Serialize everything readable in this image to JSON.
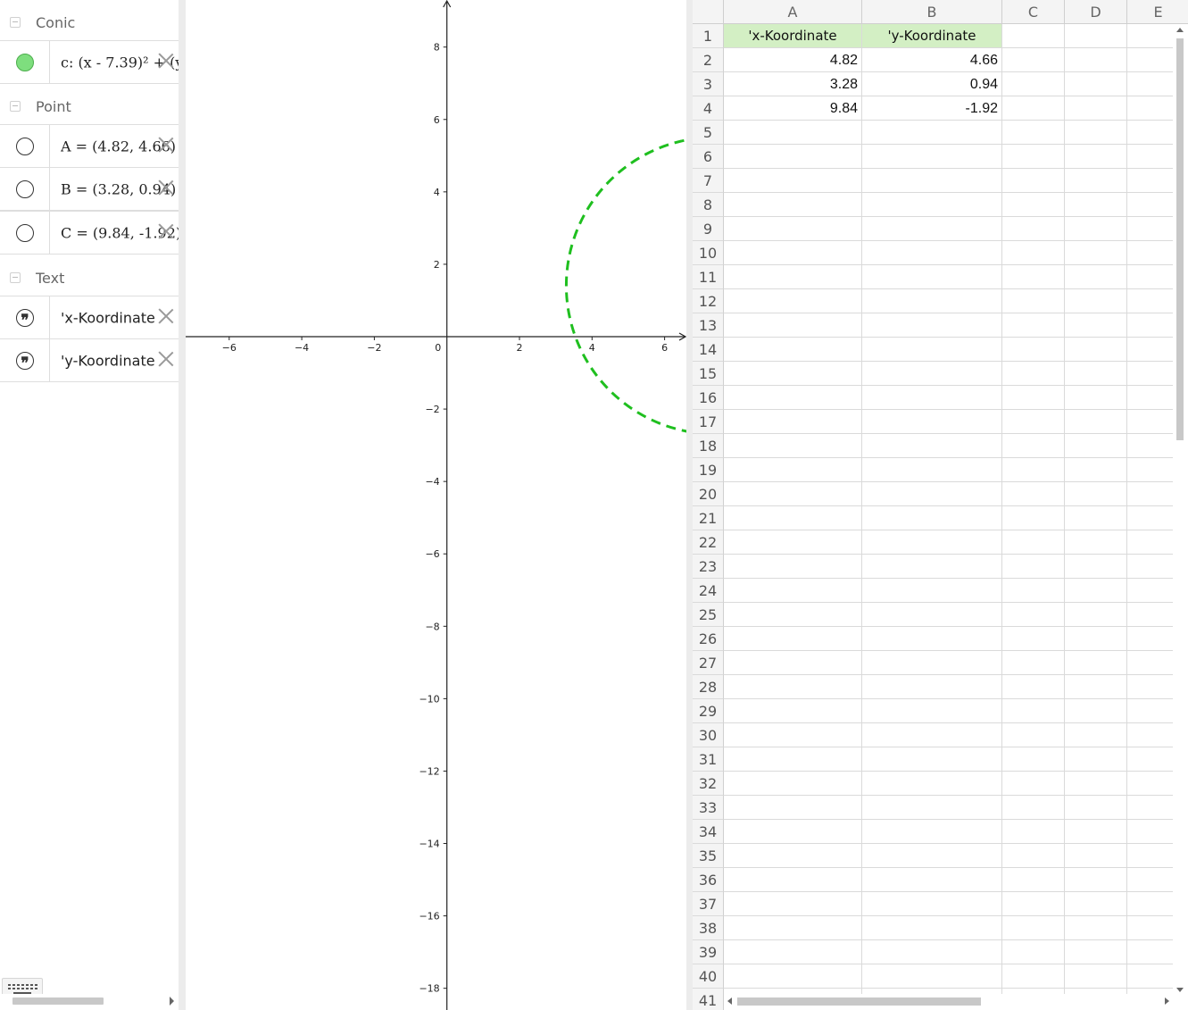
{
  "algebra": {
    "groups": [
      {
        "label": "Conic"
      },
      {
        "label": "Point"
      },
      {
        "label": "Text"
      }
    ],
    "items": [
      {
        "text": "c: (x - 7.39)² + (y",
        "marble": "filled"
      },
      {
        "text": "A = (4.82, 4.66)",
        "marble": "empty"
      },
      {
        "text": "B = (3.28, 0.94)",
        "marble": "empty"
      },
      {
        "text": "C = (9.84, -1.92)",
        "marble": "empty"
      },
      {
        "text": "'x-Koordinate",
        "marble": "quote"
      },
      {
        "text": "'y-Koordinate",
        "marble": "quote"
      }
    ]
  },
  "graphics": {
    "x_ticks": [
      "−6",
      "−4",
      "−2",
      "0",
      "2",
      "4",
      "6"
    ],
    "y_ticks": [
      "8",
      "6",
      "4",
      "2",
      "−2",
      "−4",
      "−6",
      "−8",
      "−10",
      "−12",
      "−14",
      "−16",
      "−18"
    ],
    "conic": {
      "center_x": 7.39,
      "center_y": 1.41,
      "radius": 4.1,
      "color": "#1fbf1f",
      "style": "dashed"
    },
    "view": {
      "xmin": -7.2,
      "xmax": 6.6,
      "ymax": 9.3,
      "ymin": -18.6
    }
  },
  "spreadsheet": {
    "columns": [
      "A",
      "B",
      "C",
      "D",
      "E"
    ],
    "rows": [
      [
        "'x-Koordinate",
        "'y-Koordinate"
      ],
      [
        "4.82",
        "4.66"
      ],
      [
        "3.28",
        "0.94"
      ],
      [
        "9.84",
        "-1.92"
      ]
    ],
    "row_count": 41,
    "header_fill": "#d3efc4"
  }
}
